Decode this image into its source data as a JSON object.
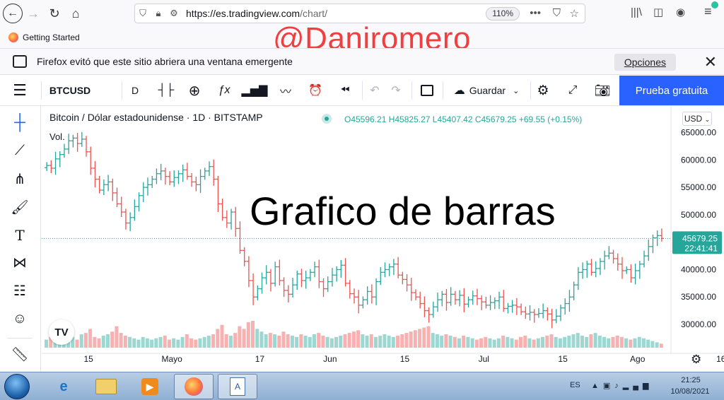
{
  "browser": {
    "url": {
      "host": "https://es.tradingview.com",
      "path": "/chart/"
    },
    "zoom": "110%",
    "bookmark": "Getting Started",
    "popup_message": "Firefox evitó que este sitio abriera una ventana emergente",
    "popup_options_label": "Opciones",
    "watermark": "@Daniromero"
  },
  "toolbar": {
    "symbol": "BTCUSD",
    "interval": "D",
    "save_label": "Guardar",
    "trial_label": "Prueba gratuita"
  },
  "chart_header": {
    "name": "Bitcoin / Dólar estadounidense · 1D · BITSTAMP",
    "ohlc": "O45596.21 H45825.27 L45407.42 C45679.25 +69.55 (+0.15%)",
    "volume_label": "Vol.",
    "currency": "USD",
    "overlay_text": "Grafico de barras",
    "logo": "TV"
  },
  "colors": {
    "up": "#26a69a",
    "down": "#ef5350",
    "accent": "#2962ff"
  },
  "chart_data": {
    "type": "bar",
    "subtype": "ohlc",
    "price_ticks": [
      65000,
      60000,
      55000,
      50000,
      45000,
      40000,
      35000,
      30000
    ],
    "price_tick_labels": [
      "65000.00",
      "60000.00",
      "55000.00",
      "50000.00",
      "45000.00",
      "40000.00",
      "35000.00",
      "30000.00"
    ],
    "last_price": {
      "label": "45679.25",
      "countdown": "22:41:41",
      "value": 45679.25
    },
    "x_tick_labels": [
      "15",
      "Mayo",
      "17",
      "Jun",
      "15",
      "Jul",
      "15",
      "Ago",
      "16"
    ],
    "ylim": [
      26000,
      66500
    ],
    "close": [
      59000,
      58500,
      60200,
      61000,
      62000,
      63500,
      64000,
      63000,
      63800,
      61500,
      58500,
      56500,
      54500,
      55500,
      56000,
      54000,
      52000,
      50500,
      48500,
      49500,
      51500,
      53500,
      55000,
      55500,
      56500,
      57500,
      58000,
      57000,
      56000,
      56800,
      57500,
      58200,
      57000,
      56000,
      55500,
      57000,
      58000,
      58800,
      56500,
      52000,
      49500,
      48500,
      50500,
      47500,
      43500,
      41500,
      38000,
      35000,
      36500,
      38500,
      39500,
      37500,
      40500,
      38000,
      36200,
      35500,
      37200,
      39200,
      38000,
      38500,
      39500,
      40500,
      37800,
      36500,
      37800,
      39000,
      40000,
      40800,
      37500,
      35600,
      35000,
      33500,
      34500,
      36000,
      35000,
      37800,
      39500,
      40000,
      40500,
      41000,
      39000,
      38200,
      37200,
      35800,
      35000,
      33800,
      32500,
      31800,
      33200,
      34500,
      35500,
      34000,
      35500,
      34500,
      35300,
      33700,
      34500,
      35200,
      34700,
      34100,
      33500,
      34000,
      34300,
      35000,
      32900,
      33300,
      33500,
      33200,
      32300,
      31900,
      32200,
      31800,
      32000,
      32500,
      31900,
      30800,
      31500,
      33000,
      33800,
      35000,
      37200,
      39500,
      40000,
      41000,
      39500,
      40200,
      41500,
      42500,
      43000,
      42000,
      41000,
      39800,
      40000,
      38500,
      39800,
      41000,
      42500,
      44200,
      45800,
      46200,
      45700
    ],
    "volume_rel": [
      0.3,
      0.4,
      0.5,
      0.35,
      0.45,
      0.6,
      0.4,
      0.3,
      0.5,
      0.55,
      0.7,
      0.4,
      0.35,
      0.45,
      0.5,
      0.6,
      0.8,
      0.55,
      0.45,
      0.4,
      0.35,
      0.3,
      0.4,
      0.35,
      0.3,
      0.35,
      0.4,
      0.45,
      0.3,
      0.35,
      0.3,
      0.4,
      0.5,
      0.35,
      0.3,
      0.35,
      0.4,
      0.45,
      0.5,
      0.7,
      0.85,
      0.5,
      0.45,
      0.55,
      0.8,
      0.7,
      0.95,
      1.0,
      0.7,
      0.6,
      0.5,
      0.55,
      0.5,
      0.45,
      0.6,
      0.5,
      0.45,
      0.4,
      0.5,
      0.45,
      0.4,
      0.5,
      0.55,
      0.45,
      0.4,
      0.35,
      0.4,
      0.45,
      0.5,
      0.55,
      0.6,
      0.65,
      0.5,
      0.45,
      0.5,
      0.4,
      0.45,
      0.5,
      0.45,
      0.4,
      0.45,
      0.5,
      0.55,
      0.6,
      0.65,
      0.7,
      0.75,
      0.8,
      0.55,
      0.5,
      0.45,
      0.5,
      0.45,
      0.4,
      0.35,
      0.45,
      0.4,
      0.35,
      0.3,
      0.35,
      0.4,
      0.35,
      0.3,
      0.35,
      0.45,
      0.4,
      0.35,
      0.3,
      0.4,
      0.45,
      0.35,
      0.3,
      0.35,
      0.4,
      0.45,
      0.5,
      0.4,
      0.35,
      0.4,
      0.45,
      0.5,
      0.55,
      0.45,
      0.4,
      0.5,
      0.55,
      0.45,
      0.4,
      0.35,
      0.4,
      0.45,
      0.4,
      0.35,
      0.3,
      0.35,
      0.4,
      0.35,
      0.3,
      0.25,
      0.2,
      0.15
    ]
  },
  "taskbar": {
    "lang": "ES",
    "time": "21:25",
    "date": "10/08/2021"
  }
}
